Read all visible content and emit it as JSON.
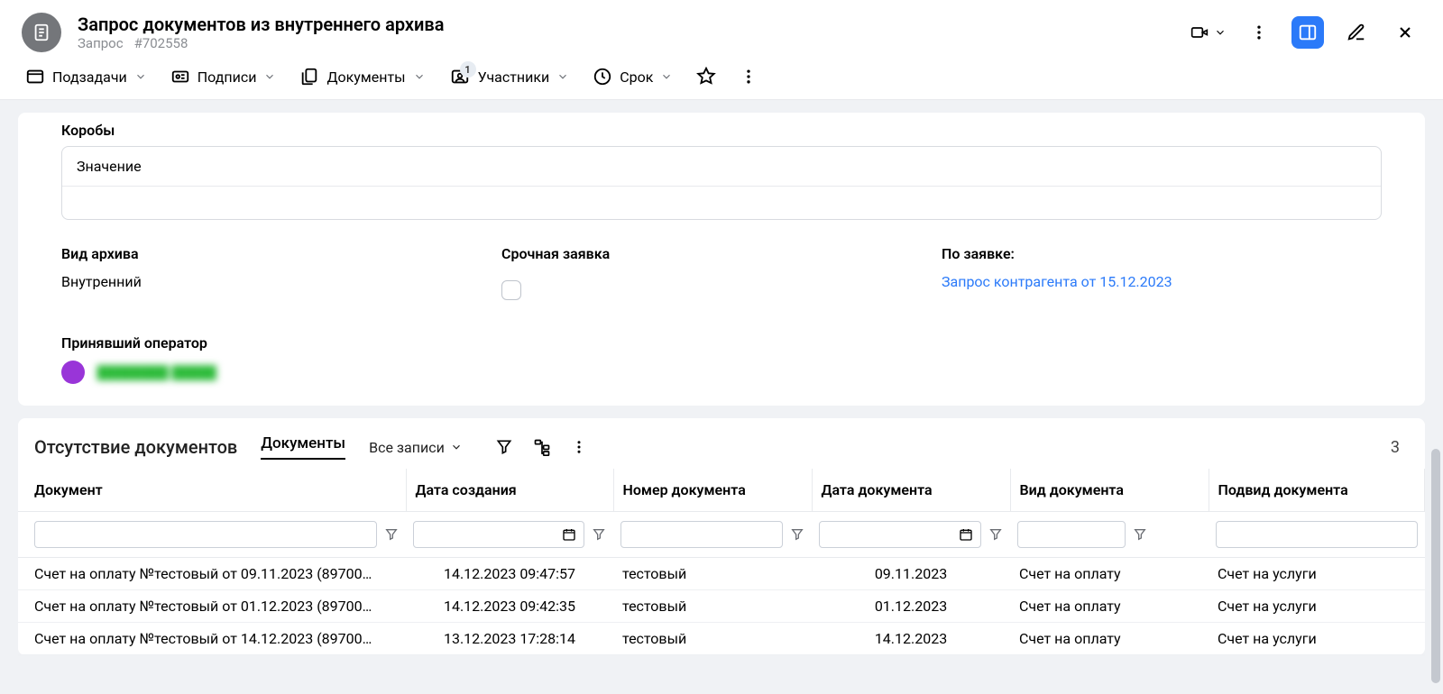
{
  "header": {
    "title": "Запрос документов из внутреннего архива",
    "type": "Запрос",
    "id": "#702558"
  },
  "toolbar": {
    "subtasks": "Подзадачи",
    "signatures": "Подписи",
    "documents": "Документы",
    "participants": "Участники",
    "participants_badge": "1",
    "deadline": "Срок"
  },
  "form": {
    "boxes_label": "Коробы",
    "boxes_head": "Значение",
    "archive_type_label": "Вид архива",
    "archive_type_value": "Внутренний",
    "urgent_label": "Срочная заявка",
    "by_request_label": "По заявке:",
    "by_request_link": "Запрос контрагента от 15.12.2023",
    "operator_label": "Принявший оператор",
    "operator_name": "████████ █████"
  },
  "table": {
    "section_title": "Отсутствие документов",
    "tab": "Документы",
    "filter_select": "Все записи",
    "count": "3",
    "columns": {
      "doc": "Документ",
      "created": "Дата создания",
      "num": "Номер документа",
      "doc_date": "Дата документа",
      "doc_type": "Вид документа",
      "doc_subtype": "Подвид документа"
    },
    "rows": [
      {
        "doc": "Счет на оплату №тестовый от 09.11.2023 (89700…",
        "created": "14.12.2023 09:47:57",
        "num": "тестовый",
        "doc_date": "09.11.2023",
        "doc_type": "Счет на оплату",
        "doc_subtype": "Счет на услуги"
      },
      {
        "doc": "Счет на оплату №тестовый от 01.12.2023 (89700…",
        "created": "14.12.2023 09:42:35",
        "num": "тестовый",
        "doc_date": "01.12.2023",
        "doc_type": "Счет на оплату",
        "doc_subtype": "Счет на услуги"
      },
      {
        "doc": "Счет на оплату №тестовый от 14.12.2023 (89700…",
        "created": "13.12.2023 17:28:14",
        "num": "тестовый",
        "doc_date": "14.12.2023",
        "doc_type": "Счет на оплату",
        "doc_subtype": "Счет на услуги"
      }
    ]
  }
}
